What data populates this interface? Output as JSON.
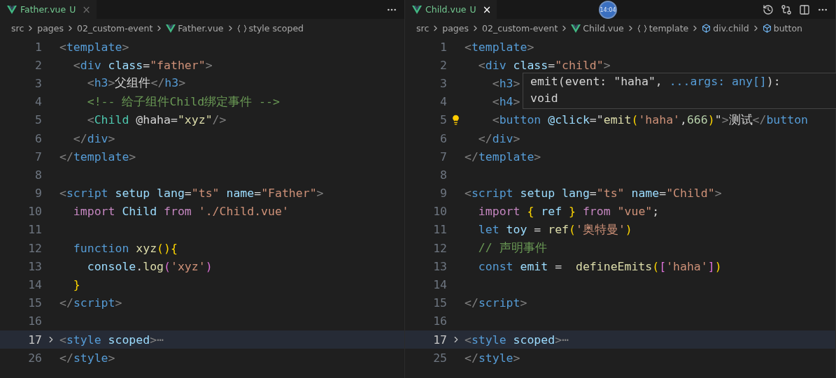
{
  "panes": [
    {
      "tab": {
        "name": "Father.vue",
        "status": "U",
        "close": "×",
        "active": false
      },
      "breadcrumbs": [
        {
          "label": "src",
          "kind": "plain"
        },
        {
          "label": "pages",
          "kind": "plain"
        },
        {
          "label": "02_custom-event",
          "kind": "plain"
        },
        {
          "label": "Father.vue",
          "kind": "vue"
        },
        {
          "label": "style scoped",
          "kind": "braces"
        }
      ],
      "actions": [
        {
          "kind": "more"
        }
      ],
      "lines": [
        {
          "n": "1",
          "tokens": [
            {
              "text": "<",
              "kind": "p"
            },
            {
              "text": "template",
              "kind": "tag"
            },
            {
              "text": ">",
              "kind": "p"
            }
          ]
        },
        {
          "n": "2",
          "tokens": [
            {
              "text": "  <",
              "kind": "p"
            },
            {
              "text": "div",
              "kind": "tag"
            },
            {
              "text": " class",
              "kind": "attr"
            },
            {
              "text": "=",
              "kind": "t"
            },
            {
              "text": "\"father\"",
              "kind": "str"
            },
            {
              "text": ">",
              "kind": "p"
            }
          ]
        },
        {
          "n": "3",
          "tokens": [
            {
              "text": "    <",
              "kind": "p"
            },
            {
              "text": "h3",
              "kind": "tag"
            },
            {
              "text": ">",
              "kind": "p"
            },
            {
              "text": "父组件",
              "kind": "t"
            },
            {
              "text": "</",
              "kind": "p"
            },
            {
              "text": "h3",
              "kind": "tag"
            },
            {
              "text": ">",
              "kind": "p"
            }
          ]
        },
        {
          "n": "4",
          "tokens": [
            {
              "text": "    <!-- 给子组件Child绑定事件 -->",
              "kind": "cm"
            }
          ]
        },
        {
          "n": "5",
          "tokens": [
            {
              "text": "    <",
              "kind": "p"
            },
            {
              "text": "Child",
              "kind": "comp"
            },
            {
              "text": " @haha",
              "kind": "t"
            },
            {
              "text": "=",
              "kind": "t"
            },
            {
              "text": "\"xyz\"",
              "kind": "fn"
            },
            {
              "text": "/>",
              "kind": "p"
            }
          ]
        },
        {
          "n": "6",
          "tokens": [
            {
              "text": "  </",
              "kind": "p"
            },
            {
              "text": "div",
              "kind": "tag"
            },
            {
              "text": ">",
              "kind": "p"
            }
          ]
        },
        {
          "n": "7",
          "tokens": [
            {
              "text": "</",
              "kind": "p"
            },
            {
              "text": "template",
              "kind": "tag"
            },
            {
              "text": ">",
              "kind": "p"
            }
          ]
        },
        {
          "n": "8"
        },
        {
          "n": "9",
          "tokens": [
            {
              "text": "<",
              "kind": "p"
            },
            {
              "text": "script",
              "kind": "tag"
            },
            {
              "text": " setup lang",
              "kind": "attr"
            },
            {
              "text": "=",
              "kind": "t"
            },
            {
              "text": "\"ts\"",
              "kind": "str"
            },
            {
              "text": " name",
              "kind": "attr"
            },
            {
              "text": "=",
              "kind": "t"
            },
            {
              "text": "\"Father\"",
              "kind": "str"
            },
            {
              "text": ">",
              "kind": "p"
            }
          ]
        },
        {
          "n": "10",
          "tokens": [
            {
              "text": "  import",
              "kind": "kw"
            },
            {
              "text": " Child ",
              "kind": "var"
            },
            {
              "text": "from",
              "kind": "kw"
            },
            {
              "text": " './Child.vue'",
              "kind": "str"
            }
          ]
        },
        {
          "n": "11"
        },
        {
          "n": "12",
          "tokens": [
            {
              "text": "  function",
              "kind": "tag"
            },
            {
              "text": " xyz",
              "kind": "fn"
            },
            {
              "text": "(){",
              "kind": "br"
            }
          ]
        },
        {
          "n": "13",
          "tokens": [
            {
              "text": "    console",
              "kind": "var"
            },
            {
              "text": ".",
              "kind": "t"
            },
            {
              "text": "log",
              "kind": "fn"
            },
            {
              "text": "(",
              "kind": "br2"
            },
            {
              "text": "'xyz'",
              "kind": "str"
            },
            {
              "text": ")",
              "kind": "br2"
            }
          ]
        },
        {
          "n": "14",
          "tokens": [
            {
              "text": "  }",
              "kind": "br"
            }
          ]
        },
        {
          "n": "15",
          "tokens": [
            {
              "text": "</",
              "kind": "p"
            },
            {
              "text": "script",
              "kind": "tag"
            },
            {
              "text": ">",
              "kind": "p"
            }
          ]
        },
        {
          "n": "16"
        },
        {
          "n": "17",
          "folded": true,
          "current": true,
          "tokens": [
            {
              "text": "<",
              "kind": "p"
            },
            {
              "text": "style",
              "kind": "tag"
            },
            {
              "text": " scoped",
              "kind": "attr"
            },
            {
              "text": ">",
              "kind": "p"
            },
            {
              "text": "⋯",
              "kind": "p"
            }
          ]
        },
        {
          "n": "26",
          "tokens": [
            {
              "text": "</",
              "kind": "p"
            },
            {
              "text": "style",
              "kind": "tag"
            },
            {
              "text": ">",
              "kind": "p"
            }
          ]
        }
      ]
    },
    {
      "tab": {
        "name": "Child.vue",
        "status": "U",
        "close": "×",
        "active": true
      },
      "breadcrumbs": [
        {
          "label": "src",
          "kind": "plain"
        },
        {
          "label": "pages",
          "kind": "plain"
        },
        {
          "label": "02_custom-event",
          "kind": "plain"
        },
        {
          "label": "Child.vue",
          "kind": "vue"
        },
        {
          "label": "template",
          "kind": "braces"
        },
        {
          "label": "div.child",
          "kind": "box"
        },
        {
          "label": "button",
          "kind": "box"
        }
      ],
      "actions": [
        {
          "kind": "history"
        },
        {
          "kind": "compare"
        },
        {
          "kind": "split"
        },
        {
          "kind": "more"
        }
      ],
      "hover": {
        "line": "emit(event: \"haha\", ",
        "rest": "...args: any[]",
        "end": "):",
        "type": "void"
      },
      "lines": [
        {
          "n": "1",
          "tokens": [
            {
              "text": "<",
              "kind": "p"
            },
            {
              "text": "template",
              "kind": "tag"
            },
            {
              "text": ">",
              "kind": "p"
            }
          ]
        },
        {
          "n": "2",
          "tokens": [
            {
              "text": "  <",
              "kind": "p"
            },
            {
              "text": "div",
              "kind": "tag"
            },
            {
              "text": " class",
              "kind": "attr"
            },
            {
              "text": "=",
              "kind": "t"
            },
            {
              "text": "\"child\"",
              "kind": "str"
            },
            {
              "text": ">",
              "kind": "p"
            }
          ]
        },
        {
          "n": "3",
          "tokens": [
            {
              "text": "    <",
              "kind": "p"
            },
            {
              "text": "h3",
              "kind": "tag"
            },
            {
              "text": ">",
              "kind": "p"
            }
          ]
        },
        {
          "n": "4",
          "tokens": [
            {
              "text": "    <",
              "kind": "p"
            },
            {
              "text": "h4",
              "kind": "tag"
            },
            {
              "text": ">",
              "kind": "p"
            }
          ]
        },
        {
          "n": "5",
          "bulb": true,
          "tokens": [
            {
              "text": "    <",
              "kind": "p"
            },
            {
              "text": "button",
              "kind": "tag"
            },
            {
              "text": " @click",
              "kind": "attr"
            },
            {
              "text": "=\"",
              "kind": "t"
            },
            {
              "text": "emit",
              "kind": "fn"
            },
            {
              "text": "(",
              "kind": "br"
            },
            {
              "text": "'haha'",
              "kind": "str"
            },
            {
              "text": ",",
              "kind": "t"
            },
            {
              "text": "666",
              "kind": "num"
            },
            {
              "text": ")",
              "kind": "br"
            },
            {
              "text": "\"",
              "kind": "t"
            },
            {
              "text": ">",
              "kind": "p"
            },
            {
              "text": "测试",
              "kind": "t"
            },
            {
              "text": "</",
              "kind": "p"
            },
            {
              "text": "button",
              "kind": "tag"
            }
          ]
        },
        {
          "n": "6",
          "tokens": [
            {
              "text": "  </",
              "kind": "p"
            },
            {
              "text": "div",
              "kind": "tag"
            },
            {
              "text": ">",
              "kind": "p"
            }
          ]
        },
        {
          "n": "7",
          "tokens": [
            {
              "text": "</",
              "kind": "p"
            },
            {
              "text": "template",
              "kind": "tag"
            },
            {
              "text": ">",
              "kind": "p"
            }
          ]
        },
        {
          "n": "8"
        },
        {
          "n": "9",
          "tokens": [
            {
              "text": "<",
              "kind": "p"
            },
            {
              "text": "script",
              "kind": "tag"
            },
            {
              "text": " setup lang",
              "kind": "attr"
            },
            {
              "text": "=",
              "kind": "t"
            },
            {
              "text": "\"ts\"",
              "kind": "str"
            },
            {
              "text": " name",
              "kind": "attr"
            },
            {
              "text": "=",
              "kind": "t"
            },
            {
              "text": "\"Child\"",
              "kind": "str"
            },
            {
              "text": ">",
              "kind": "p"
            }
          ]
        },
        {
          "n": "10",
          "tokens": [
            {
              "text": "  import",
              "kind": "kw"
            },
            {
              "text": " { ",
              "kind": "br"
            },
            {
              "text": "ref",
              "kind": "var"
            },
            {
              "text": " } ",
              "kind": "br"
            },
            {
              "text": "from",
              "kind": "kw"
            },
            {
              "text": " \"vue\"",
              "kind": "str"
            },
            {
              "text": ";",
              "kind": "t"
            }
          ]
        },
        {
          "n": "11",
          "tokens": [
            {
              "text": "  let",
              "kind": "tag"
            },
            {
              "text": " toy",
              "kind": "var"
            },
            {
              "text": " = ",
              "kind": "t"
            },
            {
              "text": "ref",
              "kind": "fn"
            },
            {
              "text": "(",
              "kind": "br"
            },
            {
              "text": "'奥特曼'",
              "kind": "str"
            },
            {
              "text": ")",
              "kind": "br"
            }
          ]
        },
        {
          "n": "12",
          "tokens": [
            {
              "text": "  // 声明事件",
              "kind": "cm"
            }
          ]
        },
        {
          "n": "13",
          "tokens": [
            {
              "text": "  const",
              "kind": "tag"
            },
            {
              "text": " emit",
              "kind": "var"
            },
            {
              "text": " =  ",
              "kind": "t"
            },
            {
              "text": "defineEmits",
              "kind": "fn"
            },
            {
              "text": "(",
              "kind": "br"
            },
            {
              "text": "[",
              "kind": "br2"
            },
            {
              "text": "'haha'",
              "kind": "str"
            },
            {
              "text": "]",
              "kind": "br2"
            },
            {
              "text": ")",
              "kind": "br"
            }
          ]
        },
        {
          "n": "14"
        },
        {
          "n": "15",
          "tokens": [
            {
              "text": "</",
              "kind": "p"
            },
            {
              "text": "script",
              "kind": "tag"
            },
            {
              "text": ">",
              "kind": "p"
            }
          ]
        },
        {
          "n": "16"
        },
        {
          "n": "17",
          "folded": true,
          "current": true,
          "tokens": [
            {
              "text": "<",
              "kind": "p"
            },
            {
              "text": "style",
              "kind": "tag"
            },
            {
              "text": " scoped",
              "kind": "attr"
            },
            {
              "text": ">",
              "kind": "p"
            },
            {
              "text": "⋯",
              "kind": "p"
            }
          ]
        },
        {
          "n": "25",
          "tokens": [
            {
              "text": "</",
              "kind": "p"
            },
            {
              "text": "style",
              "kind": "tag"
            },
            {
              "text": ">",
              "kind": "p"
            }
          ]
        }
      ]
    }
  ],
  "timer": "14:04"
}
